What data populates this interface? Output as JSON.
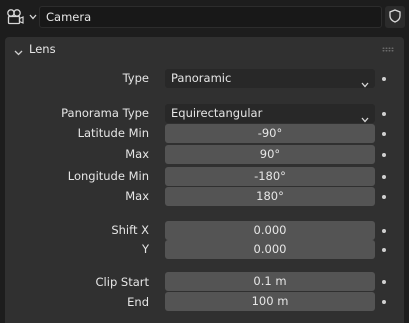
{
  "header": {
    "object_name": "Camera"
  },
  "lens_panel": {
    "title": "Lens",
    "type": {
      "label": "Type",
      "value": "Panoramic"
    },
    "panorama_type": {
      "label": "Panorama Type",
      "value": "Equirectangular"
    },
    "latitude_min": {
      "label": "Latitude Min",
      "value": "-90°"
    },
    "latitude_max": {
      "label": "Max",
      "value": "90°"
    },
    "longitude_min": {
      "label": "Longitude Min",
      "value": "-180°"
    },
    "longitude_max": {
      "label": "Max",
      "value": "180°"
    },
    "shift_x": {
      "label": "Shift X",
      "value": "0.000"
    },
    "shift_y": {
      "label": "Y",
      "value": "0.000"
    },
    "clip_start": {
      "label": "Clip Start",
      "value": "0.1 m"
    },
    "clip_end": {
      "label": "End",
      "value": "100 m"
    }
  },
  "icons": {
    "object_type": "camera-data-icon",
    "dropdown": "chevron-down-icon",
    "pin": "shield-icon",
    "collapse": "chevron-down-icon",
    "drag": "grip-dots-icon",
    "keyframe": "keyframe-dot-icon"
  }
}
